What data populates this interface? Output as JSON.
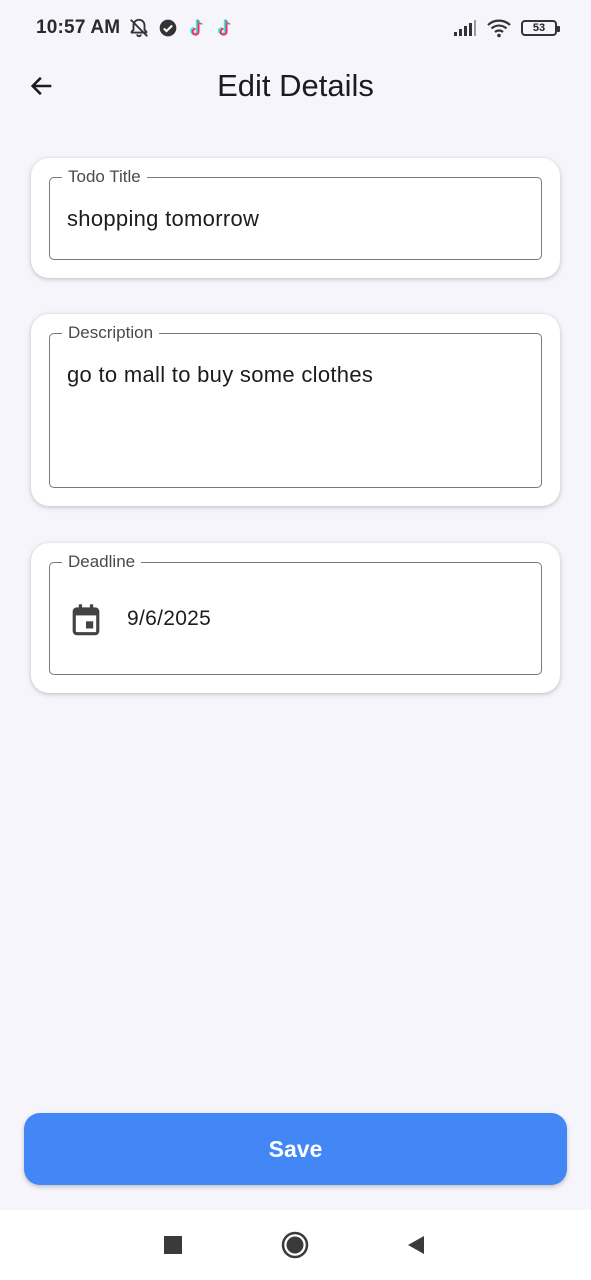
{
  "status_bar": {
    "time": "10:57 AM",
    "left_icons": [
      "notifications-off-icon",
      "verified-check-icon",
      "tiktok-icon",
      "tiktok-icon"
    ],
    "right_icons": [
      "cellular-signal-icon",
      "wifi-icon",
      "battery-icon"
    ],
    "battery_level": "53"
  },
  "app_bar": {
    "title": "Edit Details",
    "back_icon": "arrow-left-icon"
  },
  "form": {
    "title_field": {
      "label": "Todo Title",
      "value": "shopping tomorrow"
    },
    "description_field": {
      "label": "Description",
      "value": "go to mall to buy some clothes"
    },
    "deadline_field": {
      "label": "Deadline",
      "value": "9/6/2025",
      "icon": "calendar-icon"
    }
  },
  "save_button": {
    "label": "Save"
  },
  "nav_bar": {
    "buttons": [
      "recents-square-icon",
      "home-circle-icon",
      "back-triangle-icon"
    ]
  },
  "colors": {
    "accent": "#4287f5",
    "background": "#f5f5fb",
    "card": "#ffffff",
    "border": "#7a7a7a",
    "text": "#1c1b1f"
  }
}
